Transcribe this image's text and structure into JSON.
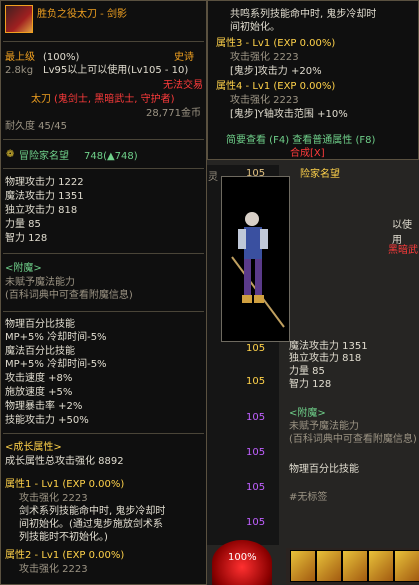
{
  "bg": {
    "label_ling": "灵",
    "nums": [
      "105",
      "105",
      "105",
      "105",
      "105",
      "105",
      "105",
      "105"
    ],
    "orb_value": "100%",
    "right_col": {
      "mage_text": "魔法攻击力 1351",
      "indep": "独立攻击力 818",
      "str": "力量 85",
      "int": "智力 128",
      "enchant_header": "<附魔>",
      "enchant_none": "未赋予魔法能力",
      "enchant_hint": "(百科词典中可查看附魔信息)",
      "pct_skill": "物理百分比技能",
      "no_tag": "#无标签",
      "usable": "以使用",
      "heian": "黑暗武",
      "dan_shu": "险家名望"
    }
  },
  "item": {
    "name": "胜负之役太刀 - 剑影",
    "grade": "最上级",
    "grade_pct": "(100%)",
    "rarity": "史诗",
    "weight": "2.8kg",
    "level_req": "Lv95以上可以使用(Lv105 - 10)",
    "trade": "无法交易",
    "type": "太刀",
    "classes": "(鬼剑士, 黑暗武士, 守护者)",
    "price": "28,771金币",
    "durability": "耐久度 45/45",
    "fame_label": "冒险家名望",
    "fame_value": "748(▲748)",
    "stats": [
      "物理攻击力 1222",
      "魔法攻击力 1351",
      "独立攻击力 818",
      "力量 85",
      "智力 128"
    ],
    "enchant_header": "<附魔>",
    "enchant_none": "未赋予魔法能力",
    "enchant_hint": "(百科词典中可查看附魔信息)",
    "skills": [
      "物理百分比技能",
      "  MP+5% 冷却时间-5%",
      "魔法百分比技能",
      "  MP+5% 冷却时间-5%",
      "攻击速度 +8%",
      "施放速度 +5%",
      "物理暴击率 +2%",
      "技能攻击力 +50%"
    ],
    "growth_header": "<成长属性>",
    "growth_total": "成长属性总攻击强化 8892",
    "attr1_title": "属性1 - Lv1 (EXP 0.00%)",
    "attr1_boost": "攻击强化 2223",
    "attr1_desc": [
      "剑术系列技能命中时, 鬼步冷却时",
      "间初始化。(通过鬼步施放剑术系",
      "列技能时不初始化。)"
    ],
    "attr2_title": "属性2 - Lv1 (EXP 0.00%)",
    "attr2_boost": "攻击强化 2223"
  },
  "tooltip2": {
    "line1": "共鸣系列技能命中时, 鬼步冷却时",
    "line2": "间初始化。",
    "attr3_title": "属性3 - Lv1 (EXP 0.00%)",
    "attr3_boost": "攻击强化 2223",
    "attr3_effect": "[鬼步]攻击力 +20%",
    "attr4_title": "属性4 - Lv1 (EXP 0.00%)",
    "attr4_boost": "攻击强化 2223",
    "attr4_effect": "[鬼步]Y轴攻击范围 +10%",
    "brief_view": "简要查看 (F4) 查看普通属性 (F8)",
    "synth": "合成[X]"
  }
}
